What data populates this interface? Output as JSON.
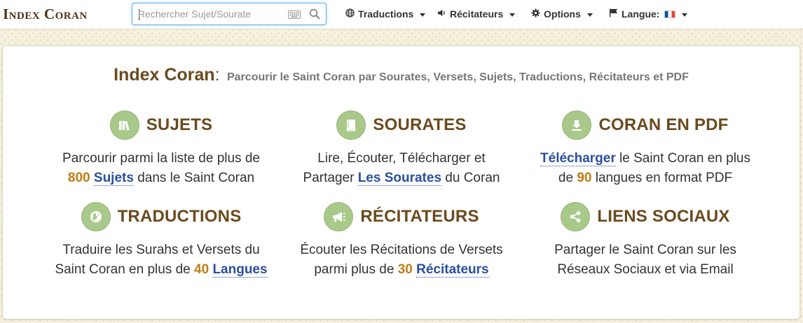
{
  "navbar": {
    "logo": "Index Coran",
    "search": {
      "placeholder": "Rechercher Sujet/Sourate",
      "value": ""
    },
    "menu_translations": "Traductions",
    "menu_reciters": "Récitateurs",
    "menu_options": "Options",
    "menu_language": "Langue:"
  },
  "hero": {
    "brand": "Index Coran",
    "separator": ":",
    "subtitle": "Parcourir le Saint Coran par Sourates, Versets, Sujets, Traductions, Récitateurs et PDF"
  },
  "features": {
    "subjects": {
      "title": "SUJETS",
      "icon": "books-icon",
      "l1": "Parcourir parmi la liste de plus de",
      "num": "800",
      "link": "Sujets",
      "tail": " dans le Saint Coran"
    },
    "surahs": {
      "title": "SOURATES",
      "icon": "book-icon",
      "l1": "Lire, Écouter, Télécharger et",
      "pre": "Partager ",
      "link": "Les Sourates",
      "tail": " du Coran"
    },
    "pdf": {
      "title": "CORAN EN PDF",
      "icon": "download-icon",
      "link": "Télécharger",
      "tail1": " le Saint Coran en plus",
      "pre": "de ",
      "num": "90",
      "tail2": " langues en format PDF"
    },
    "translations": {
      "title": "TRADUCTIONS",
      "icon": "globe-icon",
      "l1": "Traduire les Surahs et Versets du",
      "pre": "Saint Coran en plus de ",
      "num": "40",
      "link": "Langues"
    },
    "reciters": {
      "title": "RÉCITATEURS",
      "icon": "megaphone-icon",
      "l1": "Écouter les Récitations de Versets",
      "pre": "parmi plus de ",
      "num": "30",
      "link": "Récitateurs"
    },
    "social": {
      "title": "LIENS SOCIAUX",
      "icon": "share-icon",
      "l1": "Partager le Saint Coran sur les",
      "l2": "Réseaux Sociaux et via Email"
    }
  },
  "colors": {
    "brand": "#6b4a1e",
    "number": "#c07d14",
    "link": "#2a4fa0",
    "icon_circle": "#a9c98a"
  }
}
